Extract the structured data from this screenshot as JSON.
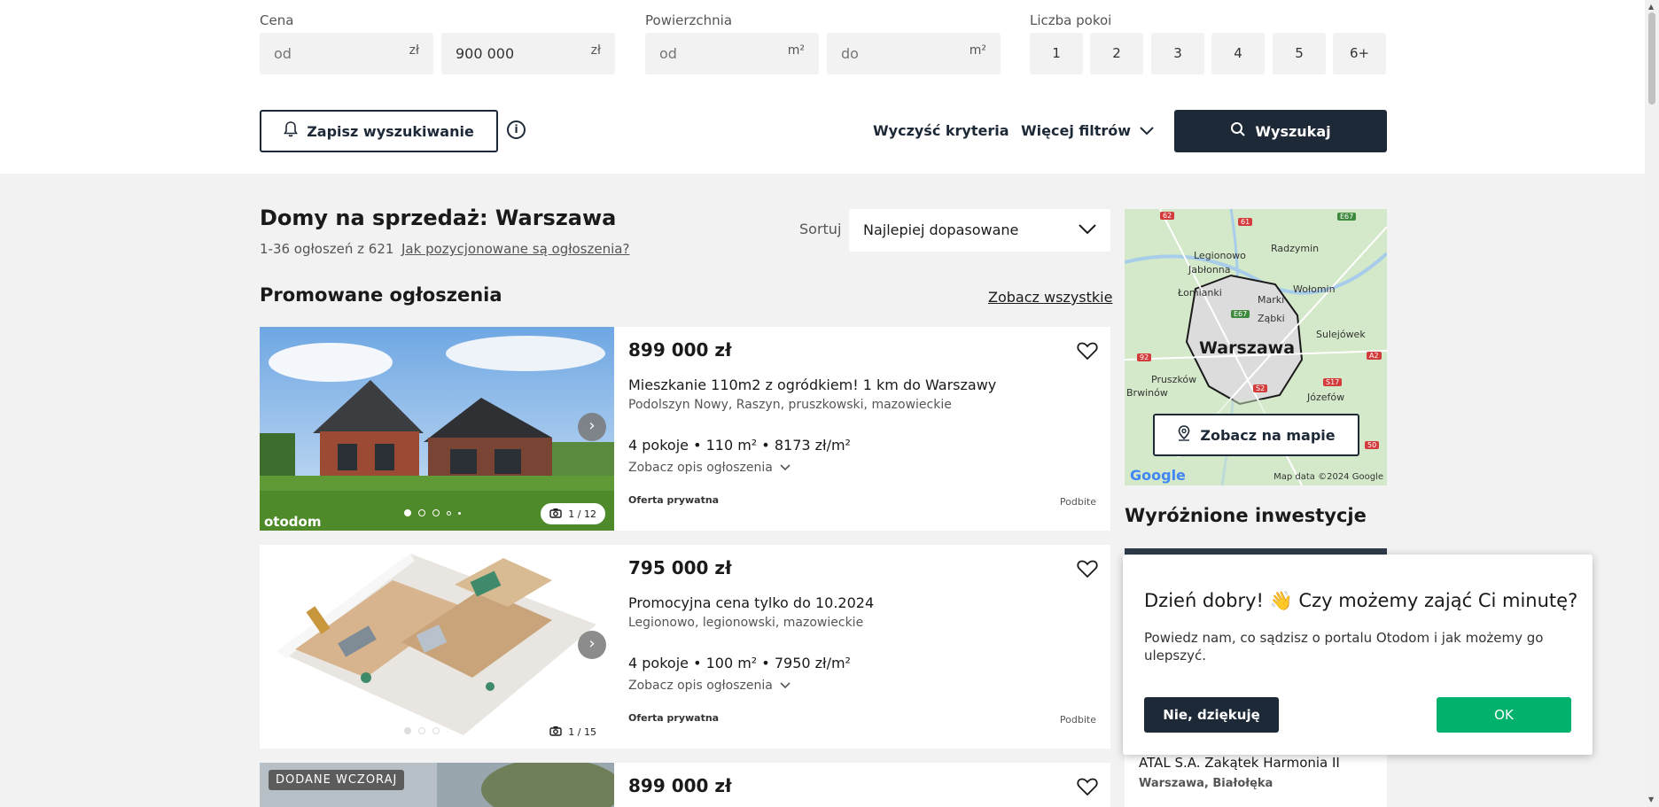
{
  "filters": {
    "price": {
      "label": "Cena",
      "from_placeholder": "od",
      "to_value": "900 000",
      "unit": "zł"
    },
    "area": {
      "label": "Powierzchnia",
      "from_placeholder": "od",
      "to_placeholder": "do",
      "unit": "m²"
    },
    "rooms": {
      "label": "Liczba pokoi",
      "options": [
        "1",
        "2",
        "3",
        "4",
        "5",
        "6+"
      ]
    },
    "save_label": "Zapisz wyszukiwanie",
    "info_glyph": "i",
    "clear_label": "Wyczyść kryteria",
    "more_label": "Więcej filtrów",
    "search_label": "Wyszukaj"
  },
  "results": {
    "title": "Domy na sprzedaż: Warszawa",
    "count": "1-36 ogłoszeń z 621",
    "position_link": "Jak pozycjonowane są ogłoszenia?",
    "sort_label": "Sortuj",
    "sort_value": "Najlepiej dopasowane"
  },
  "promoted": {
    "title": "Promowane ogłoszenia",
    "see_all": "Zobacz wszystkie"
  },
  "listings": [
    {
      "price": "899 000 zł",
      "title": "Mieszkanie 110m2 z ogródkiem! 1 km do Warszawy",
      "location": "Podolszyn Nowy, Raszyn, pruszkowski, mazowieckie",
      "specs": "4 pokoje • 110 m² • 8173 zł/m²",
      "desc_toggle": "Zobacz opis ogłoszenia",
      "owner": "Oferta prywatna",
      "bumped": "Podbite",
      "photo_counter": "1 / 12",
      "watermark": "otodom"
    },
    {
      "price": "795 000 zł",
      "title": "Promocyjna cena tylko do 10.2024",
      "location": "Legionowo, legionowski, mazowieckie",
      "specs": "4 pokoje • 100 m² • 7950 zł/m²",
      "desc_toggle": "Zobacz opis ogłoszenia",
      "owner": "Oferta prywatna",
      "bumped": "Podbite",
      "photo_counter": "1 / 15"
    },
    {
      "price": "899 000 zł",
      "badge": "DODANE WCZORAJ"
    }
  ],
  "map": {
    "city": "Warszawa",
    "places": [
      "Legionowo",
      "Jabłonna",
      "Radzymin",
      "Łomianki",
      "Wołomin",
      "Marki",
      "Ząbki",
      "Sulejówek",
      "Pruszków",
      "Brwinów",
      "Józefów"
    ],
    "roads": [
      "62",
      "61",
      "E67",
      "E67",
      "92",
      "A2",
      "S2",
      "S17",
      "50"
    ],
    "google": "Google",
    "credit": "Map data ©2024 Google",
    "button_label": "Zobacz na mapie"
  },
  "featured": {
    "title": "Wyróżnione inwestycje",
    "name": "ATAL S.A. Zakątek Harmonia II",
    "location": "Warszawa, Białołęka"
  },
  "popup": {
    "title": "Dzień dobry! 👋 Czy możemy zająć Ci minutę?",
    "text": "Powiedz nam, co sądzisz o portalu Otodom i jak możemy go ulepszyć.",
    "no_label": "Nie, dziękuję",
    "ok_label": "OK"
  },
  "colors": {
    "navy": "#1e2938",
    "green": "#00b26b",
    "page_bg": "#f2f2f2"
  }
}
